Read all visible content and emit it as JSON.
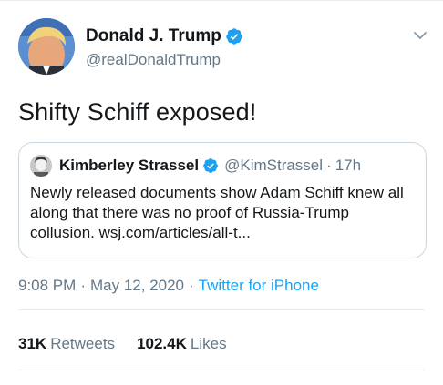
{
  "tweet": {
    "author": {
      "display_name": "Donald J. Trump",
      "handle": "@realDonaldTrump",
      "verified": true,
      "avatar_icon": "profile-photo"
    },
    "text": "Shifty Schiff exposed!",
    "quoted": {
      "author_name": "Kimberley Strassel",
      "handle": "@KimStrassel",
      "separator": "·",
      "time": "17h",
      "verified": true,
      "text": "Newly released documents show Adam Schiff knew all along that there was no proof of Russia-Trump collusion. wsj.com/articles/all-t..."
    },
    "timestamp": {
      "time": "9:08 PM",
      "separator": "·",
      "date": "May 12, 2020",
      "separator2": "·",
      "source": "Twitter for iPhone"
    },
    "stats": {
      "retweets_count": "31K",
      "retweets_label": "Retweets",
      "likes_count": "102.4K",
      "likes_label": "Likes"
    }
  },
  "colors": {
    "accent": "#1da1f2",
    "text_primary": "#14171a",
    "text_secondary": "#657786",
    "border": "#ccd6dd",
    "divider": "#e6ecf0"
  }
}
